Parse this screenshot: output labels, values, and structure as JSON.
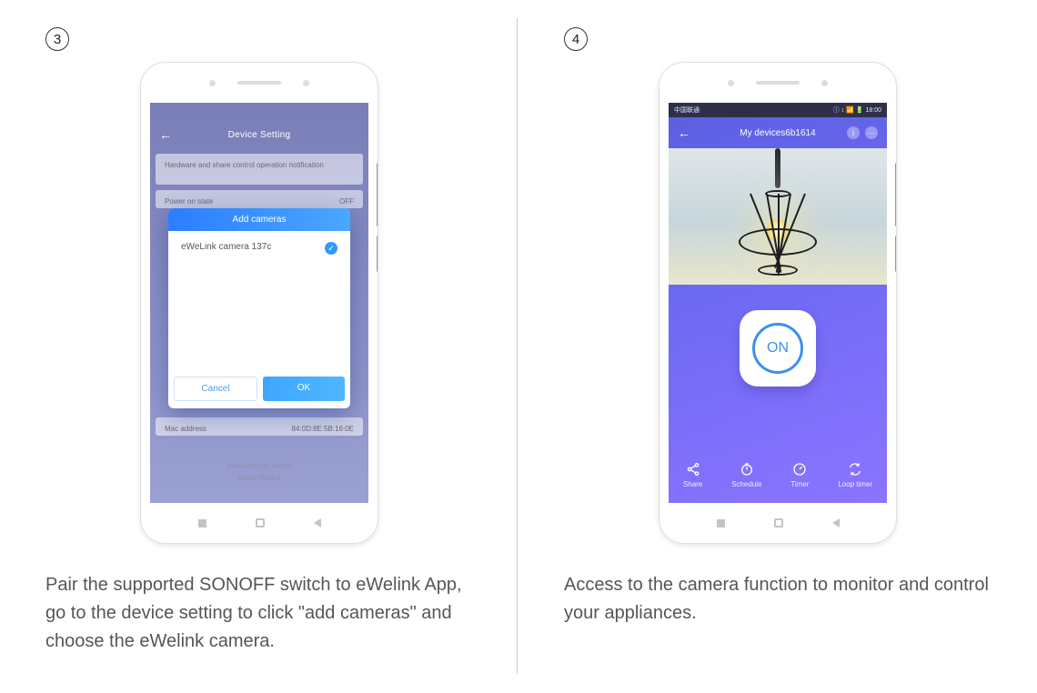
{
  "steps": {
    "s3": {
      "number": "3",
      "caption": "Pair the supported SONOFF switch to eWelink App, go to the device setting to click \"add cameras\" and choose the eWelink camera.",
      "screen": {
        "header_title": "Device Setting",
        "row_notification": "Hardware and share control operation notification",
        "row_power_label": "Power on state",
        "row_power_value": "OFF",
        "row_mac_label": "Mac address",
        "row_mac_value": "84:0D:8E:5B:16:0E",
        "meta_line1": "Manufacturer:sonoff",
        "meta_line2": "Model:Basic2",
        "modal_title": "Add cameras",
        "camera_item": "eWeLink camera 137c",
        "btn_cancel": "Cancel",
        "btn_ok": "OK"
      }
    },
    "s4": {
      "number": "4",
      "caption": "Access to the camera function to monitor and control your appliances.",
      "screen": {
        "carrier": "中国联通",
        "status_right": "ⓘ ↕ 📶 🔋 18:00",
        "header_title": "My devices6b1614",
        "info_icon": "i",
        "on_label": "ON",
        "bottom": [
          {
            "label": "Share",
            "icon": "share"
          },
          {
            "label": "Schedule",
            "icon": "clock"
          },
          {
            "label": "Timer",
            "icon": "timer"
          },
          {
            "label": "Loop timer",
            "icon": "loop"
          }
        ]
      }
    }
  }
}
